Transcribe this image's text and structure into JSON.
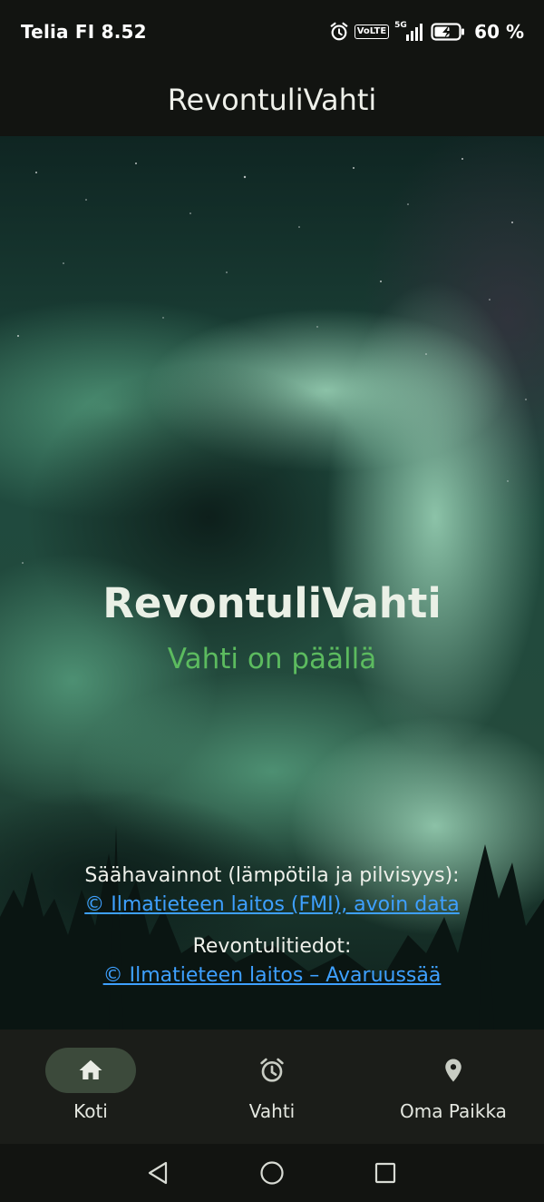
{
  "status_bar": {
    "carrier_time": "Telia FI 8.52",
    "network": "5G",
    "volte": "VoLTE",
    "battery": "60 %",
    "icons": [
      "alarm-icon",
      "volte-icon",
      "signal-icon",
      "battery-charging-icon"
    ]
  },
  "app_bar": {
    "title": "RevontuliVahti"
  },
  "hero": {
    "title": "RevontuliVahti",
    "status": "Vahti on päällä",
    "status_color": "#5cbb5f"
  },
  "credits": {
    "weather_label": "Säähavainnot (lämpötila ja pilvisyys):",
    "weather_link": "© Ilmatieteen laitos (FMI), avoin data",
    "aurora_label": "Revontulitiedot:",
    "aurora_link": "© Ilmatieteen laitos – Avaruussää",
    "link_color": "#3ea0ff"
  },
  "bottom_nav": {
    "items": [
      {
        "label": "Koti",
        "icon": "home-icon",
        "active": true
      },
      {
        "label": "Vahti",
        "icon": "alarm-clock-icon",
        "active": false
      },
      {
        "label": "Oma Paikka",
        "icon": "location-pin-icon",
        "active": false
      }
    ]
  },
  "system_nav": {
    "icons": [
      "back-icon",
      "home-circle-icon",
      "recents-icon"
    ]
  }
}
